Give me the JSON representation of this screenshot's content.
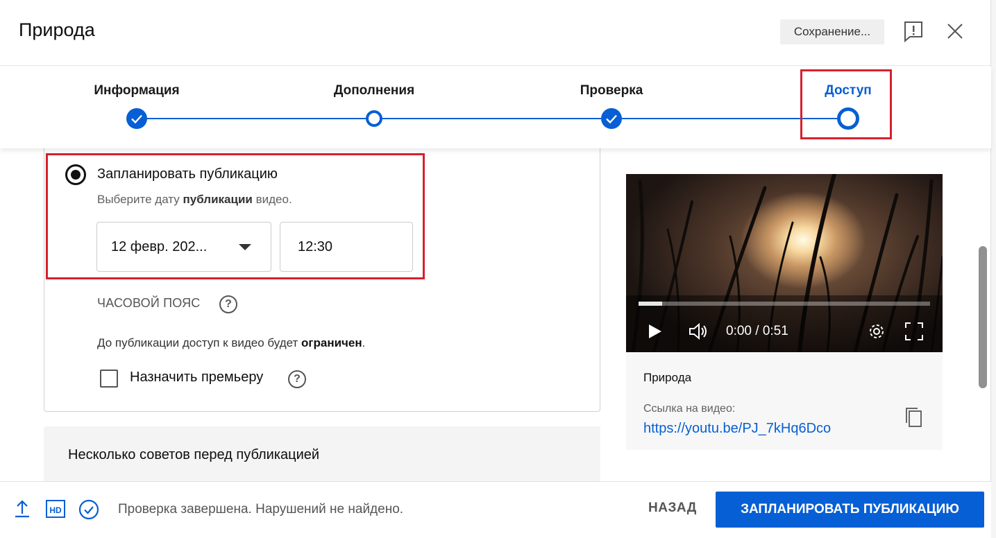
{
  "header": {
    "title": "Природа",
    "saving_label": "Сохранение..."
  },
  "stepper": {
    "steps": [
      {
        "label": "Информация",
        "state": "done"
      },
      {
        "label": "Дополнения",
        "state": "open"
      },
      {
        "label": "Проверка",
        "state": "done"
      },
      {
        "label": "Доступ",
        "state": "active"
      }
    ]
  },
  "schedule": {
    "title": "Запланировать публикацию",
    "subtitle_pre": "Выберите дату ",
    "subtitle_bold": "публикации",
    "subtitle_post": " видео.",
    "date_value": "12 февр. 202...",
    "time_value": "12:30",
    "timezone_label": "ЧАСОВОЙ ПОЯС",
    "help_glyph": "?",
    "limit_pre": "До публикации доступ к видео будет ",
    "limit_bold": "ограничен",
    "limit_post": ".",
    "premiere_label": "Назначить премьеру"
  },
  "tips": {
    "title": "Несколько советов перед публикацией"
  },
  "preview": {
    "time": "0:00 / 0:51",
    "progress": 0.08,
    "video_name": "Природа",
    "link_label": "Ссылка на видео:",
    "link": "https://youtu.be/PJ_7kHq6Dco"
  },
  "footer": {
    "status": "Проверка завершена. Нарушений не найдено.",
    "back_label": "НАЗАД",
    "primary_label": "ЗАПЛАНИРОВАТЬ ПУБЛИКАЦИЮ"
  },
  "colors": {
    "accent": "#065fd4",
    "highlight": "#d6202e"
  }
}
